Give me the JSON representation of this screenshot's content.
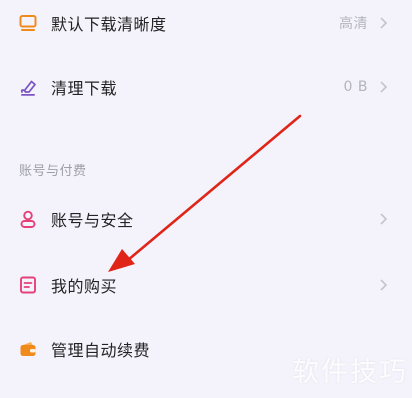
{
  "settings": {
    "download_quality": {
      "label": "默认下载清晰度",
      "value": "高清",
      "icon": "monitor-icon",
      "icon_color": "#f08a1d"
    },
    "clear_download": {
      "label": "清理下载",
      "value": "0 B",
      "icon": "eraser-icon",
      "icon_color": "#7b55c4"
    }
  },
  "account_section": {
    "header": "账号与付费",
    "items": [
      {
        "label": "账号与安全",
        "icon": "user-icon",
        "icon_color": "#e64079"
      },
      {
        "label": "我的购买",
        "icon": "receipt-icon",
        "icon_color": "#e64079"
      },
      {
        "label": "管理自动续费",
        "icon": "wallet-icon",
        "icon_color": "#f08a1d"
      }
    ]
  },
  "watermark": "软件技巧",
  "annotation": {
    "color": "#e02418"
  }
}
